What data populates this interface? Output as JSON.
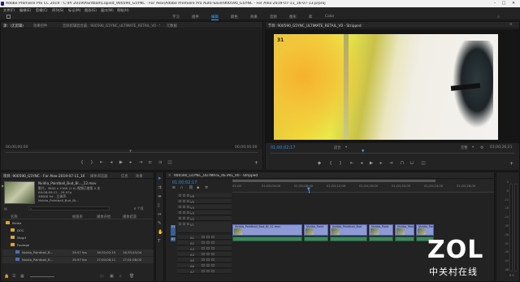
{
  "app": {
    "title": "Adobe Premiere Pro CC 2019 - C:\\Pr 2019\\Paintball\\Copied_900590_G5YNC - For Alex\\Adobe Premiere Pro Auto-Save\\900590_G5YNC - For Alex-2019-07-11_16-07-13.prproj",
    "minimize": "–",
    "maximize": "□",
    "close": "✕"
  },
  "menu": [
    "文件(F)",
    "编辑(E)",
    "剪辑(C)",
    "序列(S)",
    "标记(M)",
    "图形(G)",
    "窗口(W)",
    "帮助(H)"
  ],
  "workspaces": {
    "items": [
      "学习",
      "组件",
      "编辑",
      "颜色",
      "效果",
      "音频",
      "图形",
      "库",
      "Color"
    ],
    "active_index": 2
  },
  "source_panel": {
    "tabs": [
      "源：(无剪辑)",
      "效果控件",
      "音频剪辑混合器：900590_G5YNC_ULTIMATE_RETAIL_V0 - Stripped",
      "元数据"
    ],
    "timecode_left": "00;00;00;00",
    "timecode_right": "00;00;00;00"
  },
  "program_panel": {
    "tab": "节目: 900590_G5YNC_ULTIMATE_RETAIL_V0 - Stripped",
    "timecode_current": "01;00;02;17",
    "fit": "适合",
    "quality": "完整",
    "timecode_duration": "01;00;26;21",
    "video_overlay_label": "31"
  },
  "project_panel": {
    "tabs": [
      "项目: 900590_G5YNC - For Alex-2019-07-11_16-07-13",
      "媒体浏览器",
      "信息",
      "效果"
    ],
    "preview": {
      "name": "Nvidia_Paintball_Bud_Bl..._12.mov",
      "line1": "影片，3840 x 2160 (1.0)  视频已使用 4 次",
      "line2": "00;00;09;12 , 29.97p",
      "line3": "48000 Hz - 立体声",
      "line4": "Nvidia_Paintball_Bud_Bl..."
    },
    "search_placeholder": "",
    "item_count": "8 个项",
    "columns": [
      "名称",
      "帧速率",
      "媒体开始",
      "媒体结束"
    ],
    "rows": [
      {
        "indent": 0,
        "type": "folder",
        "name": "Media",
        "fps": "",
        "start": "",
        "end": ""
      },
      {
        "indent": 1,
        "type": "folder",
        "name": "DOC",
        "fps": "",
        "start": "",
        "end": ""
      },
      {
        "indent": 1,
        "type": "folder",
        "name": "Mogrt",
        "fps": "",
        "start": "",
        "end": ""
      },
      {
        "indent": 1,
        "type": "folder",
        "name": "Footage",
        "fps": "",
        "start": "",
        "end": ""
      },
      {
        "indent": 2,
        "type": "clip",
        "name": "Nvidia_Paintball_B...",
        "fps": "29.97 fps",
        "start": "16;32;02;15",
        "end": "16;33;43;04"
      },
      {
        "indent": 2,
        "type": "clip",
        "name": "Nvidia_Paintball_B...",
        "fps": "29.97 fps",
        "start": "17;00;08;11",
        "end": "17;01;58;03"
      }
    ]
  },
  "timeline": {
    "tab": "900590_G5YNC_ULTIMATE_RETAIL_V0 - Stripped",
    "timecode": "01;00;02;17",
    "ruler_labels": [
      "01:00",
      "01;00;04;00",
      "01;00;08;00",
      "01;00;12;00",
      "01;00;16;00",
      "01;00;20;00",
      "01;00;24;00",
      "01;00;28;00"
    ],
    "video_tracks": [
      "V6",
      "V5",
      "V4",
      "V3",
      "V2",
      "V1"
    ],
    "audio_tracks": [
      "A1",
      "A2",
      "A3",
      "A4",
      "A5",
      "A6",
      "A7"
    ],
    "source_patch_v": "V1",
    "source_patch_a": "A1",
    "clips_v1": [
      {
        "label": "Nvidia_Paintball_Bud_Bl_12.mov"
      },
      {
        "label": "Nvidia_Paint"
      },
      {
        "label": "Nvidia_Paintball_Bud"
      },
      {
        "label": "Nvidia_Paint"
      },
      {
        "label": "Nvidia_Paintb"
      },
      {
        "label": "Nvidia_Pai"
      }
    ]
  },
  "audio_meter": {
    "labels": [
      "0",
      "-6",
      "-12",
      "-18",
      "-24",
      "-30",
      "-36",
      "-42",
      "-48",
      "-54",
      "dB"
    ],
    "solo": "S S"
  },
  "watermark": {
    "logo": "ZOL",
    "text": "中关村在线"
  }
}
